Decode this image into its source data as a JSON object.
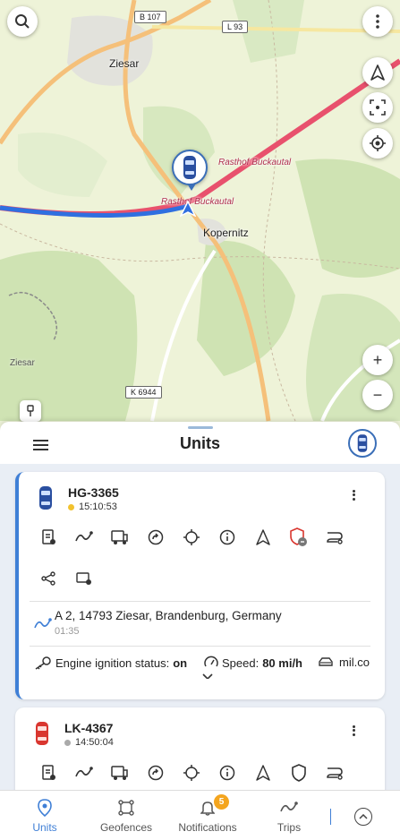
{
  "map": {
    "labels": {
      "town_ziesar": "Ziesar",
      "town_kopernitz": "Kopernitz",
      "poi_rasthof_1": "Rasthof Buckautal",
      "poi_rasthof_2": "Rasthof Buckautal",
      "area_ziesar": "Ziesar",
      "road_b107": "B 107",
      "road_l93": "L 93",
      "road_k6944": "K 6944"
    },
    "buttons": {
      "search_icon": "search-icon",
      "menu_icon": "more-vertical-icon",
      "compass_icon": "navigation-icon",
      "screenshot_icon": "focus-frame-icon",
      "locate_icon": "crosshair-icon",
      "zoom_in": "+",
      "zoom_out": "−",
      "pin_icon": "pin-icon"
    },
    "colors": {
      "route": "#2f6fe0",
      "highway": "#e8516d",
      "road": "#f5c07a"
    }
  },
  "sheet": {
    "title": "Units",
    "units": [
      {
        "name": "HG-3365",
        "time": "15:10:53",
        "status_color": "#f2c22e",
        "car_color": "#2a4fa0",
        "selected": true,
        "address": "A 2, 14793 Ziesar, Brandenburg, Germany",
        "address_time": "01:35",
        "ignition_label": "Engine ignition status:",
        "ignition_value": "on",
        "speed_label": "Speed:",
        "speed_value": "80 mi/h",
        "mileage_label": "mil.co"
      },
      {
        "name": "LK-4367",
        "time": "14:50:04",
        "status_color": "#aaaaaa",
        "car_color": "#d9362f",
        "selected": false
      }
    ]
  },
  "bottom_nav": {
    "items": [
      {
        "label": "Units",
        "active": true
      },
      {
        "label": "Geofences",
        "active": false
      },
      {
        "label": "Notifications",
        "active": false,
        "badge": "5"
      },
      {
        "label": "Trips",
        "active": false
      }
    ]
  },
  "colors": {
    "accent": "#3f7fd6",
    "badge": "#f4a51e"
  }
}
